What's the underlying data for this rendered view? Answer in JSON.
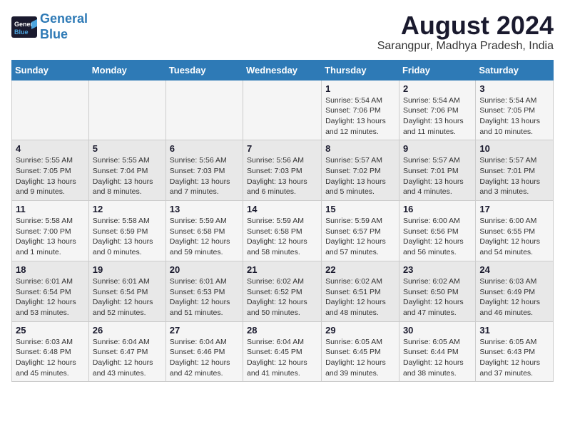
{
  "logo": {
    "line1": "General",
    "line2": "Blue"
  },
  "title": {
    "month_year": "August 2024",
    "location": "Sarangpur, Madhya Pradesh, India"
  },
  "headers": [
    "Sunday",
    "Monday",
    "Tuesday",
    "Wednesday",
    "Thursday",
    "Friday",
    "Saturday"
  ],
  "weeks": [
    [
      {
        "day": "",
        "detail": ""
      },
      {
        "day": "",
        "detail": ""
      },
      {
        "day": "",
        "detail": ""
      },
      {
        "day": "",
        "detail": ""
      },
      {
        "day": "1",
        "detail": "Sunrise: 5:54 AM\nSunset: 7:06 PM\nDaylight: 13 hours\nand 12 minutes."
      },
      {
        "day": "2",
        "detail": "Sunrise: 5:54 AM\nSunset: 7:06 PM\nDaylight: 13 hours\nand 11 minutes."
      },
      {
        "day": "3",
        "detail": "Sunrise: 5:54 AM\nSunset: 7:05 PM\nDaylight: 13 hours\nand 10 minutes."
      }
    ],
    [
      {
        "day": "4",
        "detail": "Sunrise: 5:55 AM\nSunset: 7:05 PM\nDaylight: 13 hours\nand 9 minutes."
      },
      {
        "day": "5",
        "detail": "Sunrise: 5:55 AM\nSunset: 7:04 PM\nDaylight: 13 hours\nand 8 minutes."
      },
      {
        "day": "6",
        "detail": "Sunrise: 5:56 AM\nSunset: 7:03 PM\nDaylight: 13 hours\nand 7 minutes."
      },
      {
        "day": "7",
        "detail": "Sunrise: 5:56 AM\nSunset: 7:03 PM\nDaylight: 13 hours\nand 6 minutes."
      },
      {
        "day": "8",
        "detail": "Sunrise: 5:57 AM\nSunset: 7:02 PM\nDaylight: 13 hours\nand 5 minutes."
      },
      {
        "day": "9",
        "detail": "Sunrise: 5:57 AM\nSunset: 7:01 PM\nDaylight: 13 hours\nand 4 minutes."
      },
      {
        "day": "10",
        "detail": "Sunrise: 5:57 AM\nSunset: 7:01 PM\nDaylight: 13 hours\nand 3 minutes."
      }
    ],
    [
      {
        "day": "11",
        "detail": "Sunrise: 5:58 AM\nSunset: 7:00 PM\nDaylight: 13 hours\nand 1 minute."
      },
      {
        "day": "12",
        "detail": "Sunrise: 5:58 AM\nSunset: 6:59 PM\nDaylight: 13 hours\nand 0 minutes."
      },
      {
        "day": "13",
        "detail": "Sunrise: 5:59 AM\nSunset: 6:58 PM\nDaylight: 12 hours\nand 59 minutes."
      },
      {
        "day": "14",
        "detail": "Sunrise: 5:59 AM\nSunset: 6:58 PM\nDaylight: 12 hours\nand 58 minutes."
      },
      {
        "day": "15",
        "detail": "Sunrise: 5:59 AM\nSunset: 6:57 PM\nDaylight: 12 hours\nand 57 minutes."
      },
      {
        "day": "16",
        "detail": "Sunrise: 6:00 AM\nSunset: 6:56 PM\nDaylight: 12 hours\nand 56 minutes."
      },
      {
        "day": "17",
        "detail": "Sunrise: 6:00 AM\nSunset: 6:55 PM\nDaylight: 12 hours\nand 54 minutes."
      }
    ],
    [
      {
        "day": "18",
        "detail": "Sunrise: 6:01 AM\nSunset: 6:54 PM\nDaylight: 12 hours\nand 53 minutes."
      },
      {
        "day": "19",
        "detail": "Sunrise: 6:01 AM\nSunset: 6:54 PM\nDaylight: 12 hours\nand 52 minutes."
      },
      {
        "day": "20",
        "detail": "Sunrise: 6:01 AM\nSunset: 6:53 PM\nDaylight: 12 hours\nand 51 minutes."
      },
      {
        "day": "21",
        "detail": "Sunrise: 6:02 AM\nSunset: 6:52 PM\nDaylight: 12 hours\nand 50 minutes."
      },
      {
        "day": "22",
        "detail": "Sunrise: 6:02 AM\nSunset: 6:51 PM\nDaylight: 12 hours\nand 48 minutes."
      },
      {
        "day": "23",
        "detail": "Sunrise: 6:02 AM\nSunset: 6:50 PM\nDaylight: 12 hours\nand 47 minutes."
      },
      {
        "day": "24",
        "detail": "Sunrise: 6:03 AM\nSunset: 6:49 PM\nDaylight: 12 hours\nand 46 minutes."
      }
    ],
    [
      {
        "day": "25",
        "detail": "Sunrise: 6:03 AM\nSunset: 6:48 PM\nDaylight: 12 hours\nand 45 minutes."
      },
      {
        "day": "26",
        "detail": "Sunrise: 6:04 AM\nSunset: 6:47 PM\nDaylight: 12 hours\nand 43 minutes."
      },
      {
        "day": "27",
        "detail": "Sunrise: 6:04 AM\nSunset: 6:46 PM\nDaylight: 12 hours\nand 42 minutes."
      },
      {
        "day": "28",
        "detail": "Sunrise: 6:04 AM\nSunset: 6:45 PM\nDaylight: 12 hours\nand 41 minutes."
      },
      {
        "day": "29",
        "detail": "Sunrise: 6:05 AM\nSunset: 6:45 PM\nDaylight: 12 hours\nand 39 minutes."
      },
      {
        "day": "30",
        "detail": "Sunrise: 6:05 AM\nSunset: 6:44 PM\nDaylight: 12 hours\nand 38 minutes."
      },
      {
        "day": "31",
        "detail": "Sunrise: 6:05 AM\nSunset: 6:43 PM\nDaylight: 12 hours\nand 37 minutes."
      }
    ]
  ]
}
